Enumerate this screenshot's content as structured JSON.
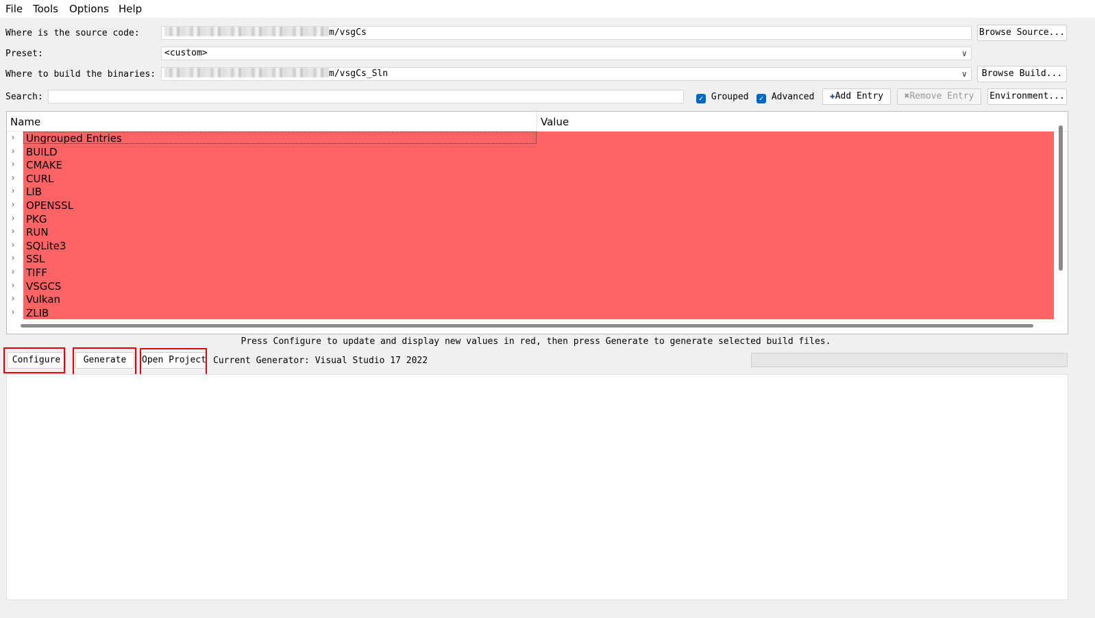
{
  "menu": [
    "File",
    "Tools",
    "Options",
    "Help"
  ],
  "source": {
    "label": "Where is the source code:",
    "value_suffix": "m/vsgCs",
    "browse_label": "Browse Source..."
  },
  "preset": {
    "label": "Preset:",
    "value": "<custom>"
  },
  "build": {
    "label": "Where to build the binaries:",
    "value_suffix": "m/vsgCs_Sln",
    "browse_label": "Browse Build..."
  },
  "search": {
    "label": "Search:",
    "value": ""
  },
  "options": {
    "grouped_label": "Grouped",
    "grouped_checked": true,
    "advanced_label": "Advanced",
    "advanced_checked": true
  },
  "toolbar": {
    "add_entry_label": "Add Entry",
    "remove_entry_label": "Remove Entry",
    "environment_label": "Environment..."
  },
  "tree": {
    "columns": [
      "Name",
      "Value"
    ],
    "highlight_color": "#ff6464",
    "rows": [
      "Ungrouped Entries",
      "BUILD",
      "CMAKE",
      "CURL",
      "LIB",
      "OPENSSL",
      "PKG",
      "RUN",
      "SQLite3",
      "SSL",
      "TIFF",
      "VSGCS",
      "Vulkan",
      "ZLIB"
    ]
  },
  "hint": "Press Configure to update and display new values in red, then press Generate to generate selected build files.",
  "actions": {
    "configure_label": "Configure",
    "generate_label": "Generate",
    "open_project_label": "Open Project",
    "generator_text": "Current Generator: Visual Studio 17 2022"
  },
  "output_text": ""
}
